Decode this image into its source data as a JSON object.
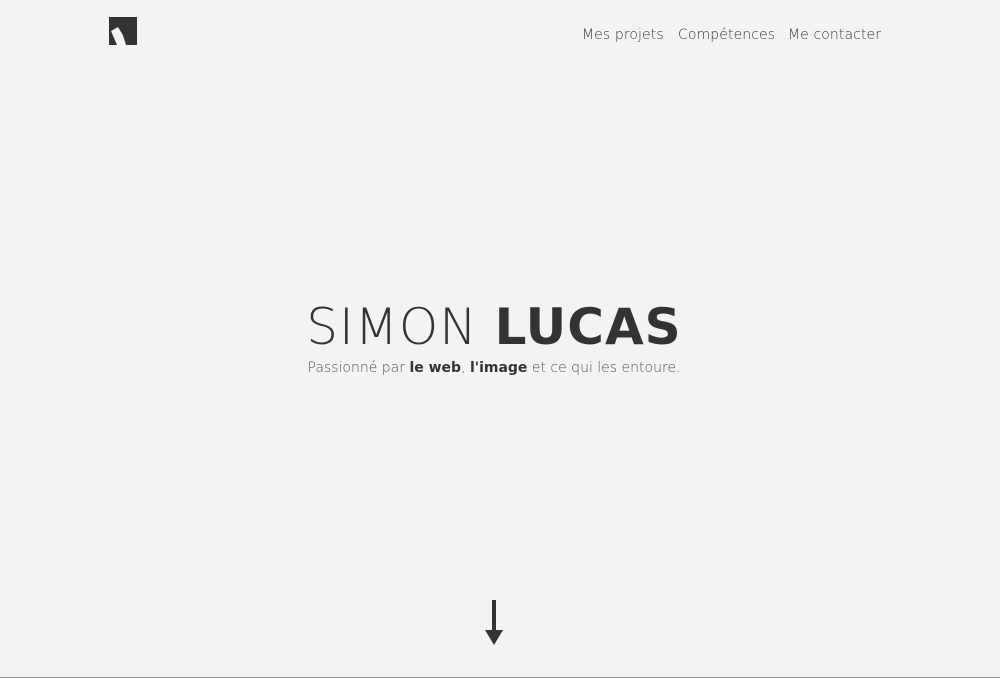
{
  "header": {
    "logo_icon": "brand-logo-icon",
    "nav": [
      {
        "label": "Mes projets"
      },
      {
        "label": "Compétences"
      },
      {
        "label": "Me contacter"
      }
    ]
  },
  "hero": {
    "first_name": "SIMON",
    "last_name": "LUCAS",
    "tagline": {
      "prefix": "Passionné par ",
      "highlight1": "le web",
      "sep": ", ",
      "highlight2": "l'image",
      "suffix": " et ce qui les entoure."
    }
  },
  "scroll_icon": "arrow-down-icon",
  "colors": {
    "background": "#f3f3f3",
    "text": "#333333"
  }
}
